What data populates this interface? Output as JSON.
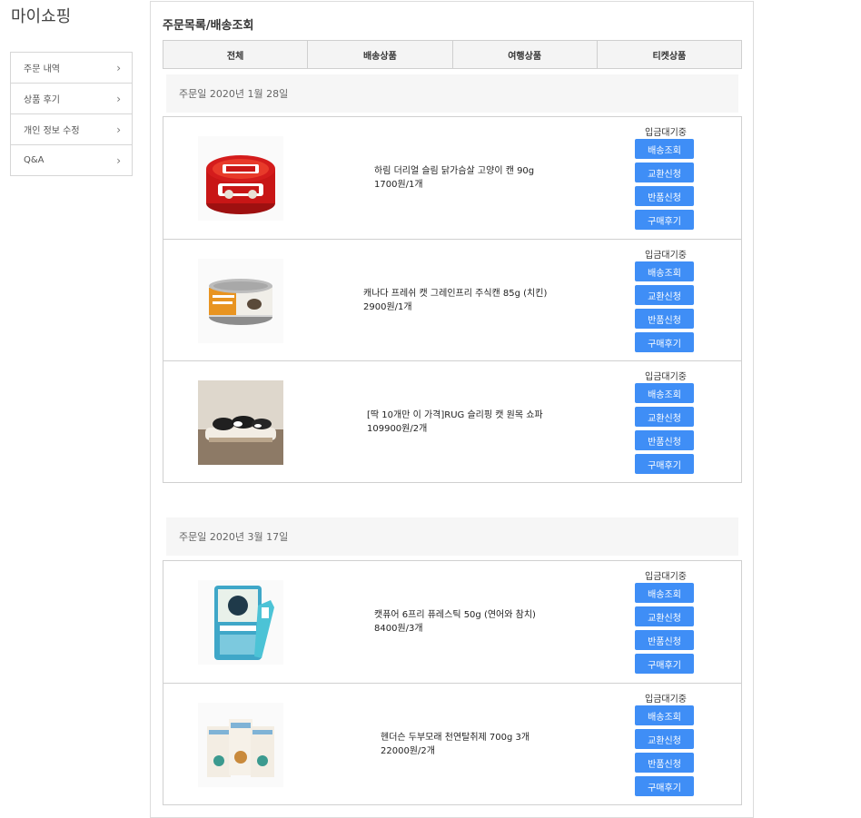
{
  "sidebar": {
    "title": "마이쇼핑",
    "items": [
      {
        "label": "주문 내역"
      },
      {
        "label": "상품 후기"
      },
      {
        "label": "개인 정보 수정"
      },
      {
        "label": "Q&A"
      }
    ]
  },
  "main": {
    "title": "주문목록/배송조회",
    "tabs": [
      "전체",
      "배송상품",
      "여행상품",
      "티켓상품"
    ],
    "orders": [
      {
        "date": "주문일 2020년 1월 28일",
        "items": [
          {
            "name": "하림 더리얼 슬림 닭가슴살 고양이 캔 90g",
            "price": "1700원/1개",
            "status": "입금대기중",
            "image_icon": "cat-food-can-red"
          },
          {
            "name": "캐나다 프레쉬 캣 그레인프리 주식캔 85g (치킨)",
            "price": "2900원/1개",
            "status": "입금대기중",
            "image_icon": "cat-food-can-orange"
          },
          {
            "name": "[딱 10개만 이 가격]RUG 슬리핑 캣 원목 쇼파",
            "price": "109900원/2개",
            "status": "입금대기중",
            "image_icon": "cat-sofa-photo"
          }
        ]
      },
      {
        "date": "주문일 2020년 3월 17일",
        "items": [
          {
            "name": "캣퓨어 6프리 퓨레스틱 50g (연어와 참치)",
            "price": "8400원/3개",
            "status": "입금대기중",
            "image_icon": "puree-stick-pack"
          },
          {
            "name": "헨더슨 두부모래 천연탈취제 700g 3개",
            "price": "22000원/2개",
            "status": "입금대기중",
            "image_icon": "litter-bags"
          }
        ]
      }
    ],
    "buttons": {
      "track": "배송조회",
      "exchange": "교환신청",
      "return": "반품신청",
      "review": "구매후기"
    }
  },
  "colors": {
    "accent": "#3f8ef6",
    "date_bar_bg": "#f6f6f6",
    "tab_bg": "#f4f4f4",
    "border": "#d0d0d0"
  }
}
